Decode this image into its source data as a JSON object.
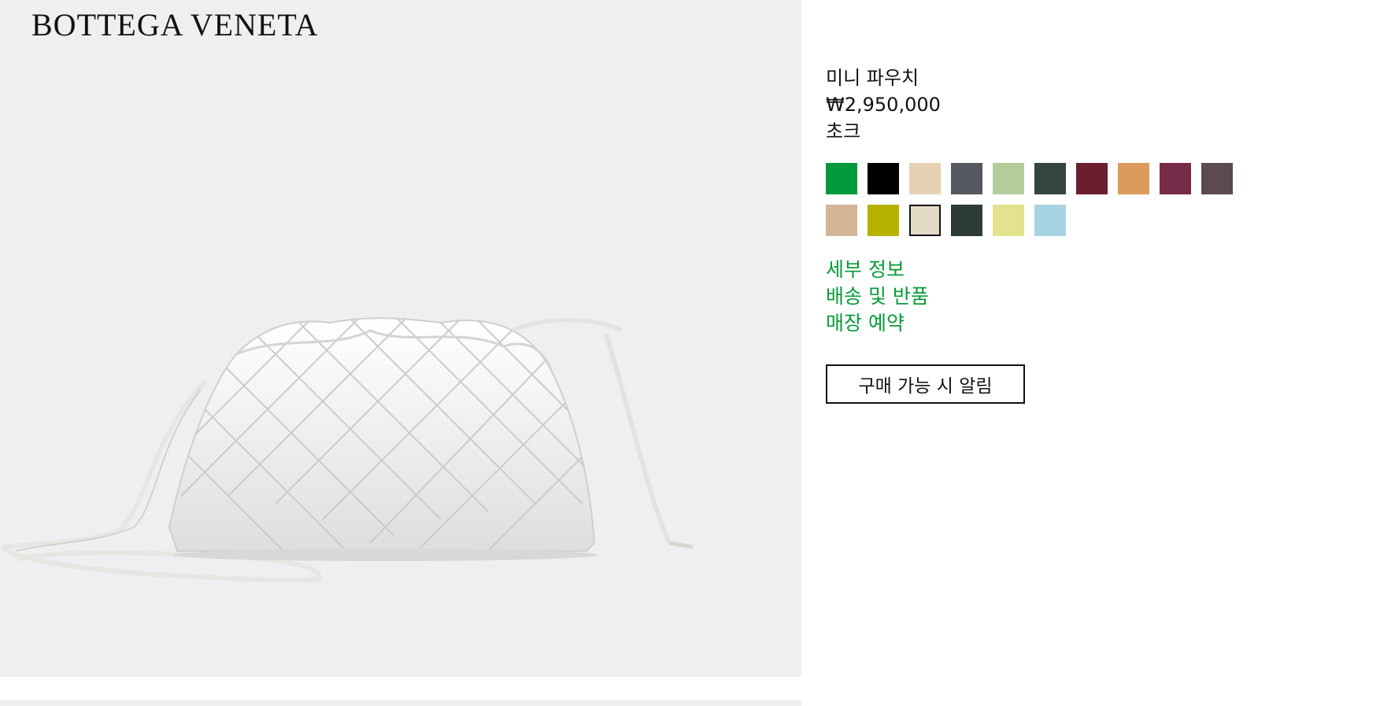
{
  "brand": {
    "logo_text": "BOTTEGA VENETA"
  },
  "product": {
    "name": "미니 파우치",
    "price": "₩2,950,000",
    "color_name": "초크",
    "image_icon": "woven-pouch-bag-image"
  },
  "swatches": [
    {
      "color": "#00993c",
      "selected": false
    },
    {
      "color": "#000000",
      "selected": false
    },
    {
      "color": "#e6d1b5",
      "selected": false
    },
    {
      "color": "#55585e",
      "selected": false
    },
    {
      "color": "#b3cc9c",
      "selected": false
    },
    {
      "color": "#34463f",
      "selected": false
    },
    {
      "color": "#6a1f2e",
      "selected": false
    },
    {
      "color": "#d99c5c",
      "selected": false
    },
    {
      "color": "#762c48",
      "selected": false
    },
    {
      "color": "#5b4a52",
      "selected": false
    },
    {
      "color": "#d4b598",
      "selected": false
    },
    {
      "color": "#b5b300",
      "selected": false
    },
    {
      "color": "#e3dac6",
      "selected": true
    },
    {
      "color": "#2e3c36",
      "selected": false
    },
    {
      "color": "#e3e38f",
      "selected": false
    },
    {
      "color": "#a8d3e3",
      "selected": false
    }
  ],
  "links": [
    {
      "label": "세부 정보"
    },
    {
      "label": "배송 및 반품"
    },
    {
      "label": "매장 예약"
    }
  ],
  "notify_button": {
    "label": "구매 가능 시 알림"
  },
  "colors": {
    "link": "#0a9a3a",
    "hero_bg": "#eeeff1"
  }
}
